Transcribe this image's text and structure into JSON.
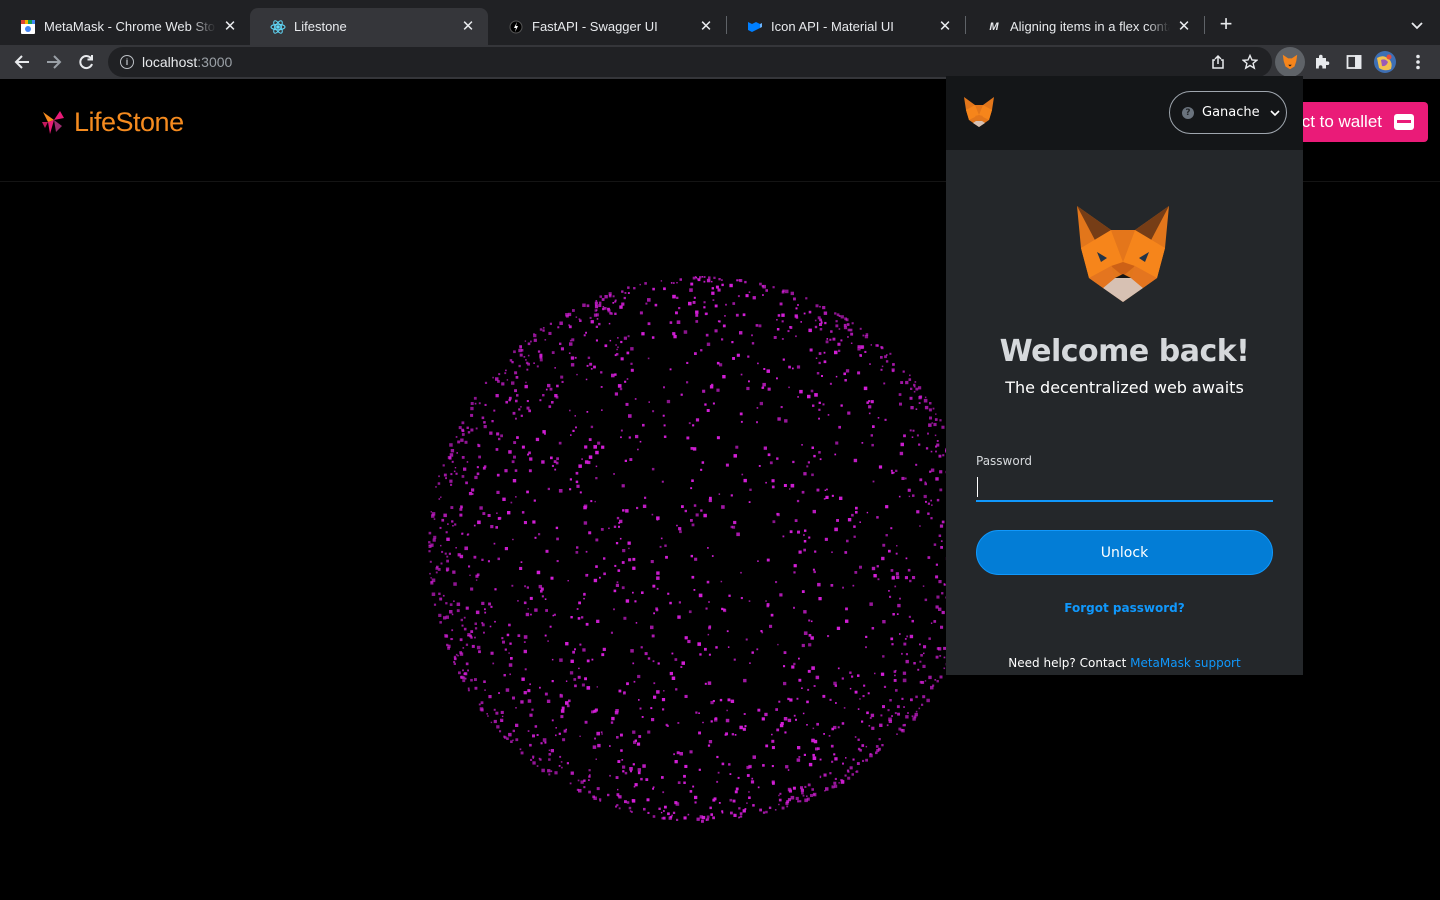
{
  "browser": {
    "tabs": [
      {
        "title": "MetaMask - Chrome Web Store",
        "active": false
      },
      {
        "title": "Lifestone",
        "active": true
      },
      {
        "title": "FastAPI - Swagger UI",
        "active": false
      },
      {
        "title": "Icon API - Material UI",
        "active": false
      },
      {
        "title": "Aligning items in a flex container",
        "active": false
      }
    ],
    "url_host": "localhost",
    "url_port": ":3000"
  },
  "site": {
    "logo_text": "LifeStone",
    "connect_button": "ct to wallet",
    "particle_color": "#d21ed6",
    "brand_pink": "#ea1b78",
    "brand_orange": "#f58b1f"
  },
  "metamask": {
    "network": "Ganache",
    "title": "Welcome back!",
    "subtitle": "The decentralized web awaits",
    "password_label": "Password",
    "password_value": "",
    "unlock_label": "Unlock",
    "forgot_label": "Forgot password?",
    "help_text": "Need help? Contact ",
    "help_link": "MetaMask support",
    "accent": "#037dd6"
  },
  "icons": {
    "back": "arrow-left-icon",
    "forward": "arrow-right-icon",
    "reload": "reload-icon",
    "info": "info-icon",
    "share": "share-icon",
    "star": "star-icon",
    "extension": "puzzle-icon",
    "sidepanel": "side-panel-icon",
    "menu": "kebab-menu-icon"
  }
}
